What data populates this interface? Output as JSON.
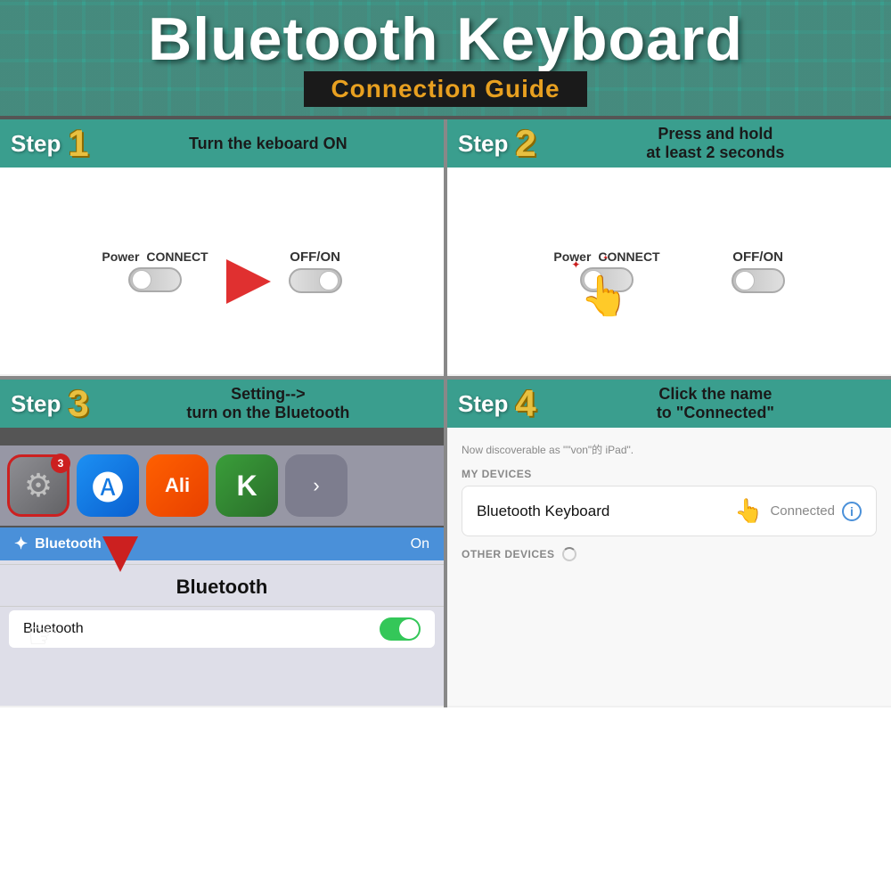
{
  "header": {
    "title": "Bluetooth Keyboard",
    "subtitle": "Connection Guide",
    "bg_color": "#3a9e8e"
  },
  "steps": [
    {
      "number": "1",
      "label": "Step",
      "description": "Turn the keboard ON",
      "left_toggle_label1": "Power",
      "left_toggle_label2": "CONNECT",
      "right_toggle_label": "OFF/ON",
      "arrow_label": ""
    },
    {
      "number": "2",
      "label": "Step",
      "description_line1": "Press and hold",
      "description_line2": "at least 2 seconds",
      "power_label": "Power",
      "connect_label": "CONNECT",
      "offon_label": "OFF/ON"
    },
    {
      "number": "3",
      "label": "Step",
      "description_line1": "Setting-->",
      "description_line2": "turn on the Bluetooth",
      "badge": "3",
      "bt_row_label": "Bluetooth",
      "bt_row_status": "On",
      "bt_title": "Bluetooth",
      "bt_setting_label": "Bluetooth"
    },
    {
      "number": "4",
      "label": "Step",
      "description_line1": "Click the name",
      "description_line2": "to \"Connected\"",
      "discoverable_text": "Now discoverable as \"\"von\"的 iPad\".",
      "my_devices_label": "MY DEVICES",
      "device_name": "Bluetooth  Keyboard",
      "connected_label": "Connected",
      "other_devices_label": "OTHER DEVICES"
    }
  ]
}
